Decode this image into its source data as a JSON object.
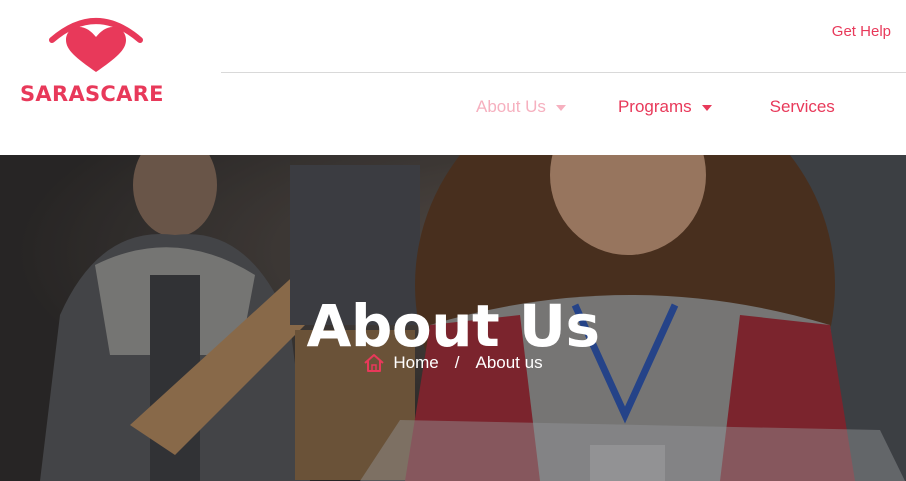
{
  "brand": {
    "name": "SARASCARE",
    "accent_color": "#e8395a"
  },
  "header": {
    "top_link": "Get Help",
    "nav": [
      {
        "label": "About Us",
        "active": true,
        "has_dropdown": true
      },
      {
        "label": "Programs",
        "active": false,
        "has_dropdown": true
      },
      {
        "label": "Services",
        "active": false,
        "has_dropdown": false
      }
    ]
  },
  "hero": {
    "title": "About Us",
    "breadcrumb": {
      "home_icon": "home-icon",
      "home_label": "Home",
      "separator": "/",
      "current": "About us"
    }
  }
}
